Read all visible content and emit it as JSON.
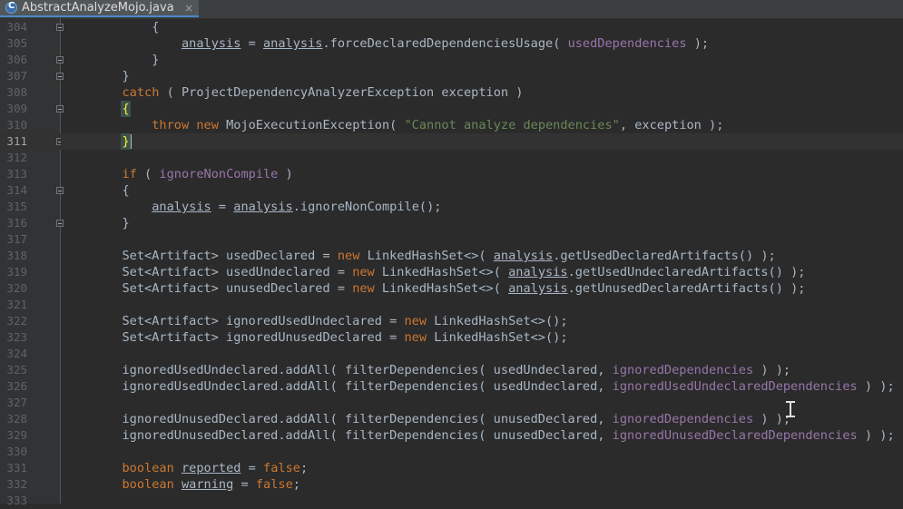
{
  "tab": {
    "title": "AbstractAnalyzeMojo.java",
    "icon": "java-class-icon",
    "close_glyph": "×"
  },
  "editor": {
    "current_line": "311",
    "caret_after": "}",
    "lines": [
      {
        "n": "304",
        "fold": true,
        "tokens": [
          [
            "            ",
            ""
          ],
          [
            "{",
            ""
          ]
        ]
      },
      {
        "n": "305",
        "tokens": [
          [
            "                ",
            ""
          ],
          [
            "analysis",
            "und"
          ],
          [
            " = ",
            ""
          ],
          [
            "analysis",
            "und"
          ],
          [
            ".forceDeclaredDependenciesUsage( ",
            ""
          ],
          [
            "usedDependencies",
            "fld"
          ],
          [
            " );",
            ""
          ]
        ]
      },
      {
        "n": "306",
        "fold": true,
        "tokens": [
          [
            "            ",
            ""
          ],
          [
            "}",
            ""
          ]
        ]
      },
      {
        "n": "307",
        "fold": true,
        "tokens": [
          [
            "        ",
            ""
          ],
          [
            "}",
            ""
          ]
        ]
      },
      {
        "n": "308",
        "tokens": [
          [
            "        ",
            ""
          ],
          [
            "catch",
            "kw"
          ],
          [
            " ( ProjectDependencyAnalyzerException exception )",
            ""
          ]
        ]
      },
      {
        "n": "309",
        "fold": true,
        "tokens": [
          [
            "        ",
            ""
          ],
          [
            "{",
            "brace-hl"
          ]
        ]
      },
      {
        "n": "310",
        "tokens": [
          [
            "            ",
            ""
          ],
          [
            "throw new",
            "kw"
          ],
          [
            " MojoExecutionException( ",
            ""
          ],
          [
            "\"Cannot analyze dependencies\"",
            "str"
          ],
          [
            ", exception );",
            ""
          ]
        ]
      },
      {
        "n": "311",
        "fold": true,
        "tokens": [
          [
            "        ",
            ""
          ],
          [
            "}",
            "brace-hl"
          ]
        ]
      },
      {
        "n": "312",
        "tokens": []
      },
      {
        "n": "313",
        "tokens": [
          [
            "        ",
            ""
          ],
          [
            "if",
            "kw"
          ],
          [
            " ( ",
            ""
          ],
          [
            "ignoreNonCompile",
            "fld"
          ],
          [
            " )",
            ""
          ]
        ]
      },
      {
        "n": "314",
        "fold": true,
        "tokens": [
          [
            "        ",
            ""
          ],
          [
            "{",
            ""
          ]
        ]
      },
      {
        "n": "315",
        "tokens": [
          [
            "            ",
            ""
          ],
          [
            "analysis",
            "und"
          ],
          [
            " = ",
            ""
          ],
          [
            "analysis",
            "und"
          ],
          [
            ".ignoreNonCompile();",
            ""
          ]
        ]
      },
      {
        "n": "316",
        "fold": true,
        "tokens": [
          [
            "        ",
            ""
          ],
          [
            "}",
            ""
          ]
        ]
      },
      {
        "n": "317",
        "tokens": []
      },
      {
        "n": "318",
        "tokens": [
          [
            "        Set<Artifact> usedDeclared = ",
            ""
          ],
          [
            "new",
            "kw"
          ],
          [
            " LinkedHashSet<>( ",
            ""
          ],
          [
            "analysis",
            "und"
          ],
          [
            ".getUsedDeclaredArtifacts() );",
            ""
          ]
        ]
      },
      {
        "n": "319",
        "tokens": [
          [
            "        Set<Artifact> usedUndeclared = ",
            ""
          ],
          [
            "new",
            "kw"
          ],
          [
            " LinkedHashSet<>( ",
            ""
          ],
          [
            "analysis",
            "und"
          ],
          [
            ".getUsedUndeclaredArtifacts() );",
            ""
          ]
        ]
      },
      {
        "n": "320",
        "tokens": [
          [
            "        Set<Artifact> unusedDeclared = ",
            ""
          ],
          [
            "new",
            "kw"
          ],
          [
            " LinkedHashSet<>( ",
            ""
          ],
          [
            "analysis",
            "und"
          ],
          [
            ".getUnusedDeclaredArtifacts() );",
            ""
          ]
        ]
      },
      {
        "n": "321",
        "tokens": []
      },
      {
        "n": "322",
        "tokens": [
          [
            "        Set<Artifact> ignoredUsedUndeclared = ",
            ""
          ],
          [
            "new",
            "kw"
          ],
          [
            " LinkedHashSet<>();",
            ""
          ]
        ]
      },
      {
        "n": "323",
        "tokens": [
          [
            "        Set<Artifact> ignoredUnusedDeclared = ",
            ""
          ],
          [
            "new",
            "kw"
          ],
          [
            " LinkedHashSet<>();",
            ""
          ]
        ]
      },
      {
        "n": "324",
        "tokens": []
      },
      {
        "n": "325",
        "tokens": [
          [
            "        ignoredUsedUndeclared.addAll( filterDependencies( usedUndeclared, ",
            ""
          ],
          [
            "ignoredDependencies",
            "fld"
          ],
          [
            " ) );",
            ""
          ]
        ]
      },
      {
        "n": "326",
        "tokens": [
          [
            "        ignoredUsedUndeclared.addAll( filterDependencies( usedUndeclared, ",
            ""
          ],
          [
            "ignoredUsedUndeclaredDependencies",
            "fld"
          ],
          [
            " ) );",
            ""
          ]
        ]
      },
      {
        "n": "327",
        "tokens": []
      },
      {
        "n": "328",
        "tokens": [
          [
            "        ignoredUnusedDeclared.addAll( filterDependencies( unusedDeclared, ",
            ""
          ],
          [
            "ignoredDependencies",
            "fld"
          ],
          [
            " ) );",
            ""
          ]
        ]
      },
      {
        "n": "329",
        "tokens": [
          [
            "        ignoredUnusedDeclared.addAll( filterDependencies( unusedDeclared, ",
            ""
          ],
          [
            "ignoredUnusedDeclaredDependencies",
            "fld"
          ],
          [
            " ) );",
            ""
          ]
        ]
      },
      {
        "n": "330",
        "tokens": []
      },
      {
        "n": "331",
        "tokens": [
          [
            "        ",
            ""
          ],
          [
            "boolean",
            "kw"
          ],
          [
            " ",
            ""
          ],
          [
            "reported",
            "und"
          ],
          [
            " = ",
            ""
          ],
          [
            "false",
            "kw"
          ],
          [
            ";",
            ""
          ]
        ]
      },
      {
        "n": "332",
        "tokens": [
          [
            "        ",
            ""
          ],
          [
            "boolean",
            "kw"
          ],
          [
            " ",
            ""
          ],
          [
            "warning",
            "und"
          ],
          [
            " = ",
            ""
          ],
          [
            "false",
            "kw"
          ],
          [
            ";",
            ""
          ]
        ]
      },
      {
        "n": "333",
        "tokens": []
      }
    ]
  }
}
